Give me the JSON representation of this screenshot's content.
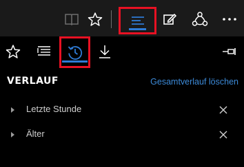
{
  "toolbar": {
    "buttons": [
      {
        "name": "reading-view",
        "icon": "book-icon"
      },
      {
        "name": "favorites",
        "icon": "star-icon"
      },
      {
        "name": "hub",
        "icon": "hub-lines-icon",
        "active": true,
        "highlighted": true
      },
      {
        "name": "web-note",
        "icon": "pen-note-icon"
      },
      {
        "name": "share",
        "icon": "share-icon"
      },
      {
        "name": "more",
        "icon": "more-icon"
      }
    ]
  },
  "panel": {
    "tabs": [
      {
        "name": "favorites",
        "icon": "star-icon"
      },
      {
        "name": "reading-list",
        "icon": "reading-list-icon"
      },
      {
        "name": "history",
        "icon": "history-clock-icon",
        "active": true,
        "highlighted": true
      },
      {
        "name": "downloads",
        "icon": "download-icon"
      }
    ],
    "pin_icon": "pin-icon",
    "title": "VERLAUF",
    "clear_link": "Gesamtverlauf löschen",
    "groups": [
      {
        "label": "Letzte Stunde"
      },
      {
        "label": "Älter"
      }
    ]
  },
  "colors": {
    "accent": "#2f7bd6",
    "highlight": "#e81123",
    "link": "#3c8ad8",
    "toolbar_bg": "#1a1a1a",
    "panel_bg": "#000000"
  }
}
